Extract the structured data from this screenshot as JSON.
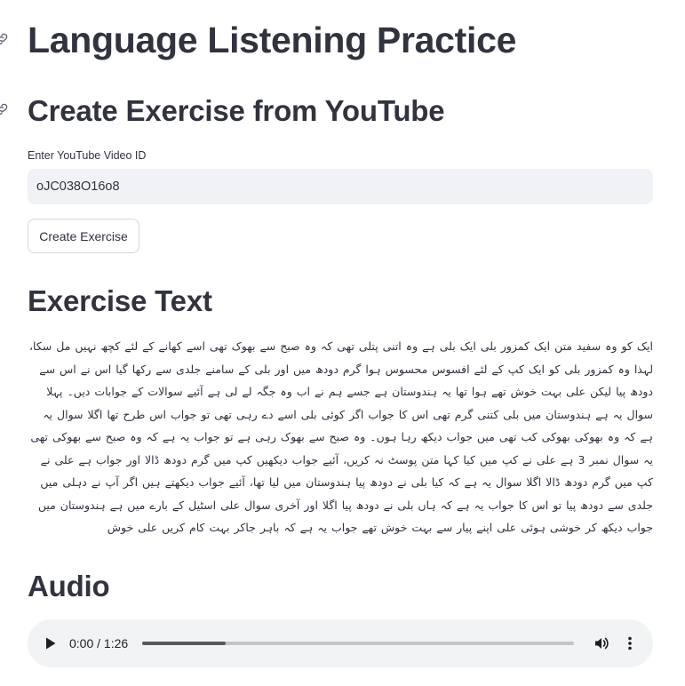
{
  "header": {
    "title": "Language Listening Practice"
  },
  "create_section": {
    "heading": "Create Exercise from YouTube",
    "video_id_label": "Enter YouTube Video ID",
    "video_id_value": "oJC038O16o8",
    "button_label": "Create Exercise"
  },
  "exercise_section": {
    "heading": "Exercise Text",
    "text": "ایک کو وہ سفید متن ایک کمزور بلی ایک بلی ہے وہ اتنی پتلی تھی کہ وہ صبح سے بھوک تھی اسے کھانے کے لئے کچھ نہیں مل سکا، لہذا وہ کمزور بلی کو ایک کپ کے لئے افسوس محسوس ہوا گرم دودھ میں اور بلی کے سامنے جلدی سے رکھا گیا اس نے اس سے دودھ پیا لیکن علی بہت خوش تھے ہوا تھا یہ ہندوستان ہے جسے ہم نے اب وہ جگہ لے لی ہے آئیے سوالات کے جوابات دیں۔ پہلا سوال یہ ہے ہندوستان میں بلی کتنی گرم تھی اس کا جواب اگر کوئی بلی اسے دے رہی تھی تو جواب اس طرح تھا اگلا سوال یہ ہے کہ وہ بھوکی بھوکی کب تھی میں جواب دیکھ رہا ہوں۔ وہ صبح سے بھوک رہی ہے تو جواب یہ ہے کہ وہ صبح سے بھوکی تھی یہ سوال نمبر 3 ہے علی نے کپ میں کیا کہا متن پوسٹ نہ کریں، آئیے جواب دیکھیں کپ میں گرم دودھ ڈالا اور جواب ہے علی نے کپ میں گرم دودھ ڈالا اگلا سوال یہ ہے کہ کیا بلی نے دودھ پیا ہندوستان میں لیا تھا، آئیے جواب دیکھتے ہیں اگر آپ نے دہلی میں جلدی سے دودھ پیا تو اس کا جواب یہ ہے کہ ہاں بلی نے دودھ پیا اگلا اور آخری سوال علی اسٹیل کے بارے میں ہے ہندوستان میں جواب دیکھ کر خوشی ہوئی علی اپنے پیار سے بہت خوش تھے جواب یہ ہے کہ باہر جاکر بہت کام کریں علی خوش"
  },
  "audio_section": {
    "heading": "Audio",
    "current_time": "0:00",
    "duration": "1:26",
    "time_display": "0:00 / 1:26",
    "buffered_fraction": 0.194,
    "icons": {
      "play": "play-icon",
      "volume": "volume-icon",
      "more": "more-options-icon"
    }
  },
  "colors": {
    "text": "#31333f",
    "input_bg": "#f0f2f6",
    "audio_bg": "#f1f3f4"
  }
}
